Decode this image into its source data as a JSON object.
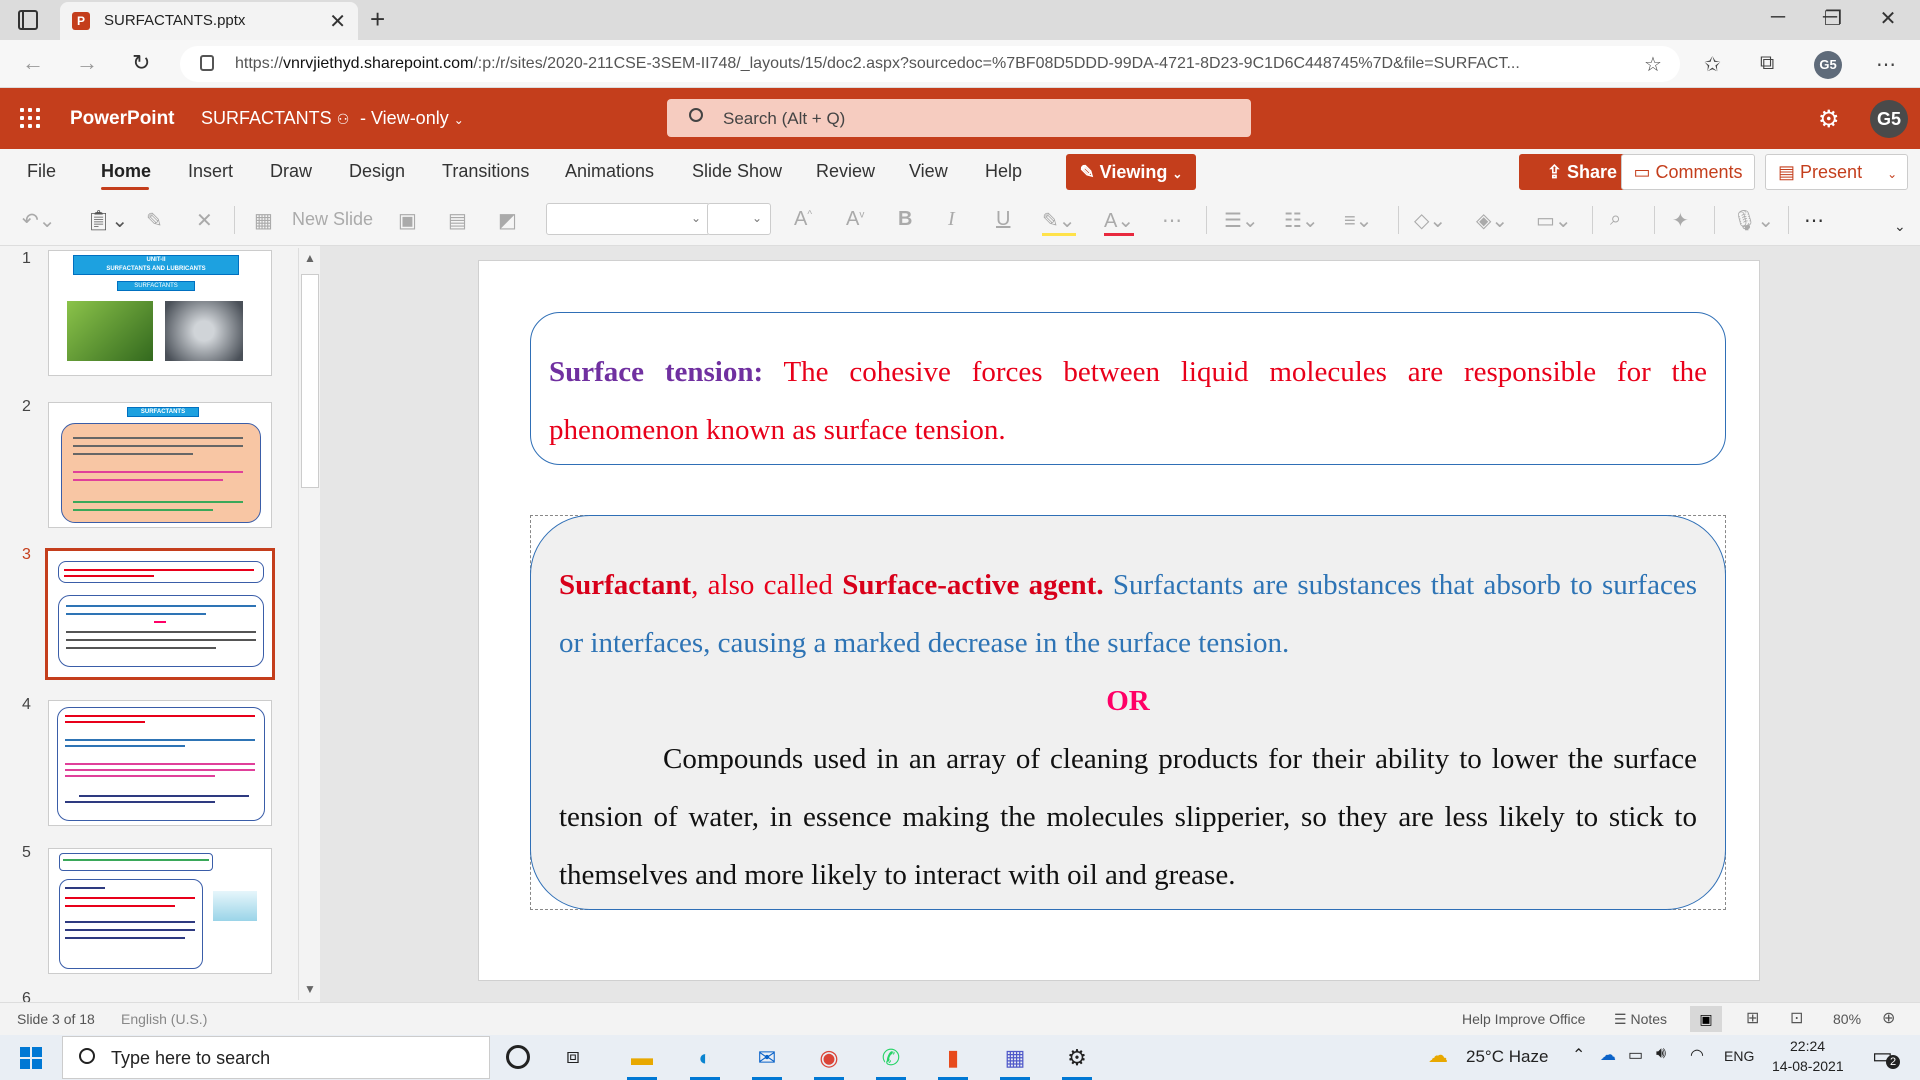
{
  "browser": {
    "tab_title": "SURFACTANTS.pptx",
    "tab_favicon": "P",
    "url_prefix": "https://",
    "url_host": "vnrvjiethyd.sharepoint.com",
    "url_path": "/:p:/r/sites/2020-211CSE-3SEM-II748/_layouts/15/doc2.aspx?sourcedoc=%7BF08D5DDD-99DA-4721-8D23-9C1D6C448745%7D&file=SURFACT...",
    "profile_initials": "G5"
  },
  "app": {
    "name": "PowerPoint",
    "doc_name": "SURFACTANTS",
    "view_mode": "View-only",
    "search_placeholder": "Search (Alt + Q)",
    "user_initials": "G5",
    "accent_color": "#c43e1c"
  },
  "ribbon": {
    "tabs": [
      "File",
      "Home",
      "Insert",
      "Draw",
      "Design",
      "Transitions",
      "Animations",
      "Slide Show",
      "Review",
      "View",
      "Help"
    ],
    "viewing_label": "Viewing",
    "share_label": "Share",
    "comments_label": "Comments",
    "present_label": "Present",
    "new_slide_label": "New Slide"
  },
  "thumbnails": {
    "numbers": [
      "1",
      "2",
      "3",
      "4",
      "5",
      "6"
    ],
    "slide1_title1": "UNIT-II",
    "slide1_title2": "SURFACTANTS AND LUBRICANTS",
    "slide1_badge": "SURFACTANTS",
    "slide2_title": "SURFACTANTS"
  },
  "slide": {
    "box1": {
      "term": "Surface tension:",
      "definition": " The cohesive forces between liquid molecules are responsible for the phenomenon known as surface tension."
    },
    "box2": {
      "term1": "Surfactant",
      "mid": ", also called ",
      "term2": "Surface-active agent.",
      "definition": " Surfactants are substances that absorb to surfaces or interfaces, causing a marked decrease in the surface tension.",
      "or": "OR",
      "alternate": "Compounds used in an array of cleaning products for their ability to lower the surface tension of water, in essence making the molecules slipperier, so they are less likely to stick to themselves and more likely to interact with oil and grease."
    }
  },
  "statusbar": {
    "slide_counter": "Slide 3 of 18",
    "language": "English (U.S.)",
    "help_improve": "Help Improve Office",
    "notes_label": "Notes",
    "zoom": "80%"
  },
  "taskbar": {
    "search_placeholder": "Type here to search",
    "weather": "25°C  Haze",
    "language": "ENG",
    "time": "22:24",
    "date": "14-08-2021",
    "notification_count": "2"
  }
}
